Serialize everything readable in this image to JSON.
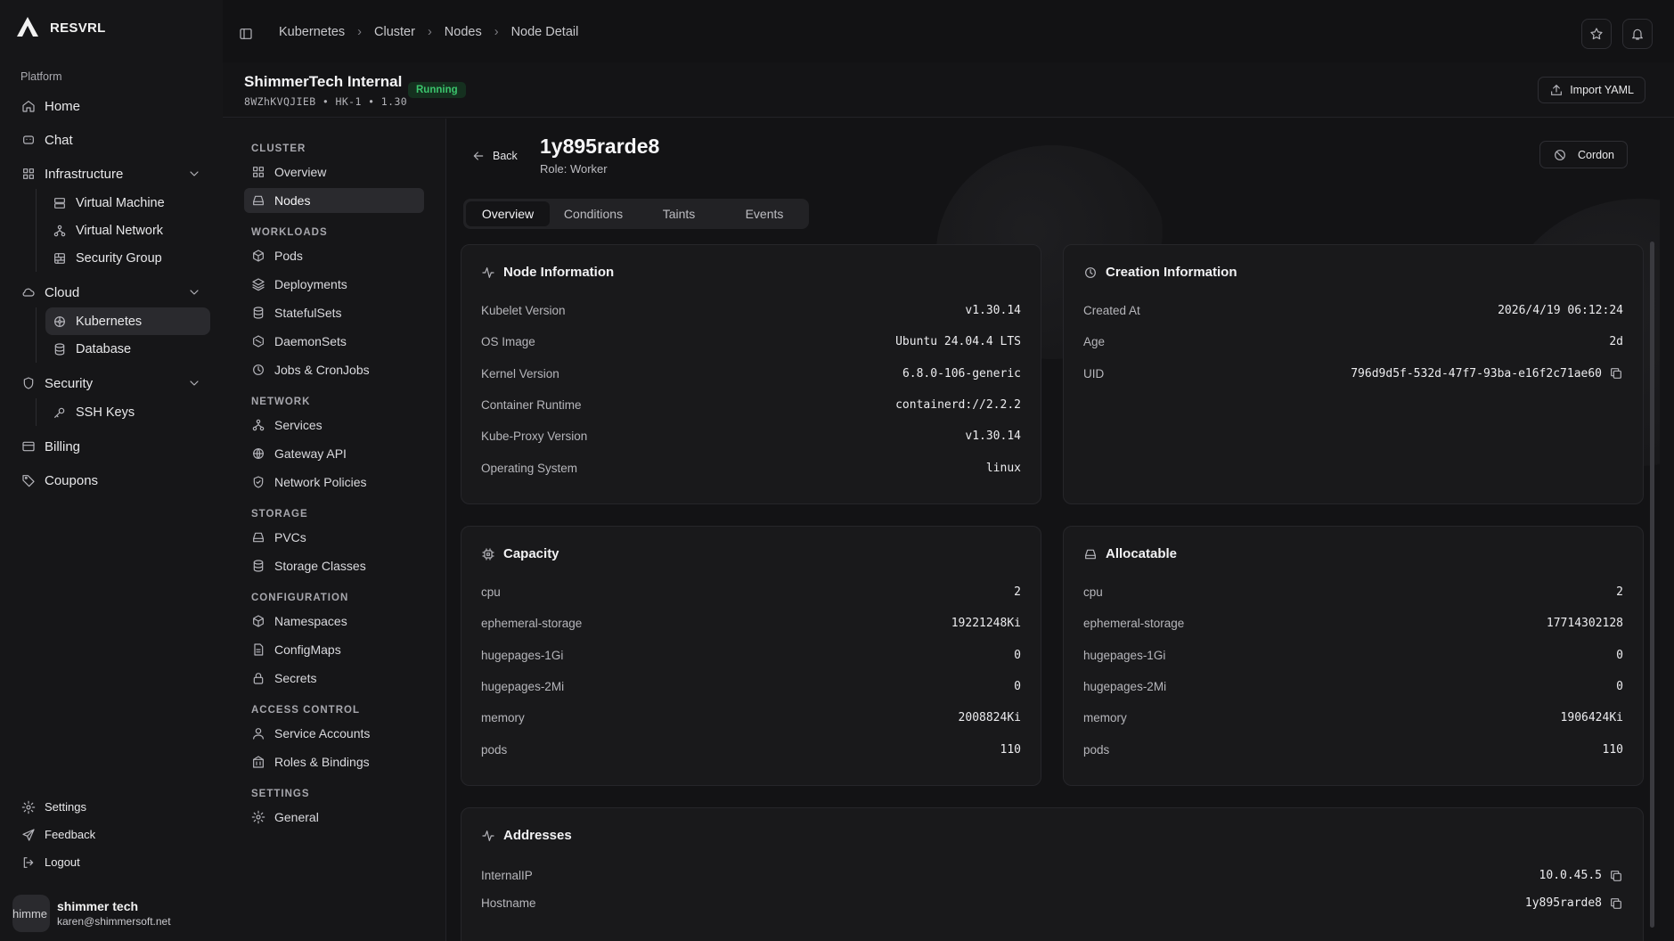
{
  "brand": {
    "name": "RESVRL"
  },
  "sidebar": {
    "section_label": "Platform",
    "items": [
      {
        "label": "Home",
        "icon": "home-icon"
      },
      {
        "label": "Chat",
        "icon": "chat-icon"
      },
      {
        "label": "Infrastructure",
        "icon": "grid-icon",
        "children": [
          "Virtual Machine",
          "Virtual Network",
          "Security Group"
        ]
      },
      {
        "label": "Cloud",
        "icon": "cloud-icon",
        "children": [
          "Kubernetes",
          "Database"
        ]
      },
      {
        "label": "Security",
        "icon": "shield-icon",
        "children": [
          "SSH Keys"
        ]
      },
      {
        "label": "Billing",
        "icon": "card-icon"
      },
      {
        "label": "Coupons",
        "icon": "tag-icon"
      }
    ],
    "bottom": {
      "settings": "Settings",
      "feedback": "Feedback",
      "logout": "Logout"
    },
    "user": {
      "avatar_text": "himme",
      "name": "shimmer tech",
      "email": "karen@shimmersoft.net"
    }
  },
  "breadcrumb": [
    "Kubernetes",
    "Cluster",
    "Nodes",
    "Node Detail"
  ],
  "cluster": {
    "name": "ShimmerTech Internal",
    "meta": "8WZhKVQJIEB  •  HK-1  •  1.30",
    "status": "Running",
    "import_label": "Import YAML"
  },
  "k8s_nav": {
    "cluster": {
      "title": "CLUSTER",
      "items": [
        "Overview",
        "Nodes"
      ]
    },
    "workloads": {
      "title": "WORKLOADS",
      "items": [
        "Pods",
        "Deployments",
        "StatefulSets",
        "DaemonSets",
        "Jobs & CronJobs"
      ]
    },
    "network": {
      "title": "NETWORK",
      "items": [
        "Services",
        "Gateway API",
        "Network Policies"
      ]
    },
    "storage": {
      "title": "STORAGE",
      "items": [
        "PVCs",
        "Storage Classes"
      ]
    },
    "configuration": {
      "title": "CONFIGURATION",
      "items": [
        "Namespaces",
        "ConfigMaps",
        "Secrets"
      ]
    },
    "access": {
      "title": "ACCESS CONTROL",
      "items": [
        "Service Accounts",
        "Roles & Bindings"
      ]
    },
    "settings": {
      "title": "SETTINGS",
      "items": [
        "General"
      ]
    }
  },
  "node": {
    "back_label": "Back",
    "name": "1y895rarde8",
    "role": "Role: Worker",
    "cordon_label": "Cordon",
    "tabs": [
      "Overview",
      "Conditions",
      "Taints",
      "Events"
    ],
    "node_info": {
      "title": "Node Information",
      "rows": [
        {
          "k": "Kubelet Version",
          "v": "v1.30.14"
        },
        {
          "k": "OS Image",
          "v": "Ubuntu 24.04.4 LTS"
        },
        {
          "k": "Kernel Version",
          "v": "6.8.0-106-generic"
        },
        {
          "k": "Container Runtime",
          "v": "containerd://2.2.2"
        },
        {
          "k": "Kube-Proxy Version",
          "v": "v1.30.14"
        },
        {
          "k": "Operating System",
          "v": "linux"
        }
      ]
    },
    "creation": {
      "title": "Creation Information",
      "rows": [
        {
          "k": "Created At",
          "v": "2026/4/19 06:12:24"
        },
        {
          "k": "Age",
          "v": "2d"
        },
        {
          "k": "UID",
          "v": "796d9d5f-532d-47f7-93ba-e16f2c71ae60"
        }
      ]
    },
    "capacity": {
      "title": "Capacity",
      "rows": [
        {
          "k": "cpu",
          "v": "2"
        },
        {
          "k": "ephemeral-storage",
          "v": "19221248Ki"
        },
        {
          "k": "hugepages-1Gi",
          "v": "0"
        },
        {
          "k": "hugepages-2Mi",
          "v": "0"
        },
        {
          "k": "memory",
          "v": "2008824Ki"
        },
        {
          "k": "pods",
          "v": "110"
        }
      ]
    },
    "allocatable": {
      "title": "Allocatable",
      "rows": [
        {
          "k": "cpu",
          "v": "2"
        },
        {
          "k": "ephemeral-storage",
          "v": "17714302128"
        },
        {
          "k": "hugepages-1Gi",
          "v": "0"
        },
        {
          "k": "hugepages-2Mi",
          "v": "0"
        },
        {
          "k": "memory",
          "v": "1906424Ki"
        },
        {
          "k": "pods",
          "v": "110"
        }
      ]
    },
    "addresses": {
      "title": "Addresses",
      "rows": [
        {
          "k": "InternalIP",
          "v": "10.0.45.5"
        },
        {
          "k": "Hostname",
          "v": "1y895rarde8"
        }
      ]
    }
  },
  "colors": {
    "accent_green": "#3bc46c",
    "background": "#141416",
    "card": "#19191b"
  }
}
